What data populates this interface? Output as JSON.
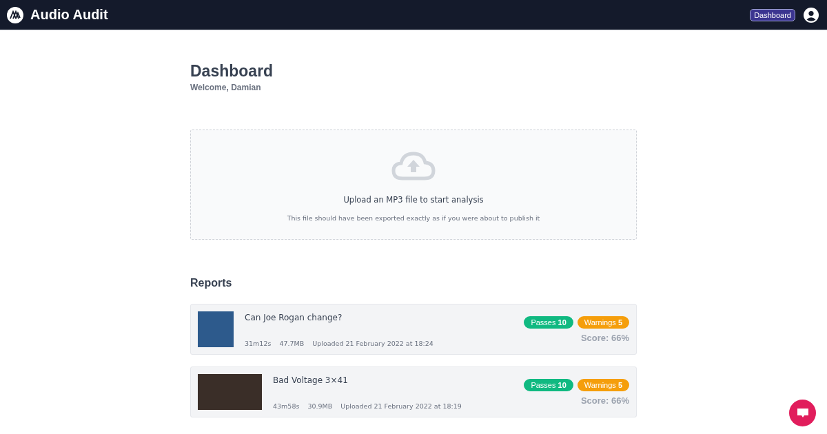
{
  "navbar": {
    "brand": "Audio Audit",
    "dashboard_link": "Dashboard"
  },
  "page": {
    "title": "Dashboard",
    "subtitle": "Welcome, Damian"
  },
  "upload": {
    "prompt": "Upload an MP3 file to start analysis",
    "hint": "This file should have been exported exactly as if you were about to publish it"
  },
  "reports_heading": "Reports",
  "reports": [
    {
      "kind": "square_thumbnail",
      "title": "Can Joe Rogan change?",
      "duration": "31m12s",
      "size": "47.7MB",
      "uploaded": "Uploaded 21 February 2022 at 18:24",
      "passes_label": "Passes",
      "passes": "10",
      "warnings_label": "Warnings",
      "warnings": "5",
      "score": "Score: 66%"
    },
    {
      "kind": "wide_thumbnail",
      "title": "Bad Voltage 3×41",
      "duration": "43m58s",
      "size": "30.9MB",
      "uploaded": "Uploaded 21 February 2022 at 18:19",
      "passes_label": "Passes",
      "passes": "10",
      "warnings_label": "Warnings",
      "warnings": "5",
      "score": "Score: 66%"
    }
  ]
}
